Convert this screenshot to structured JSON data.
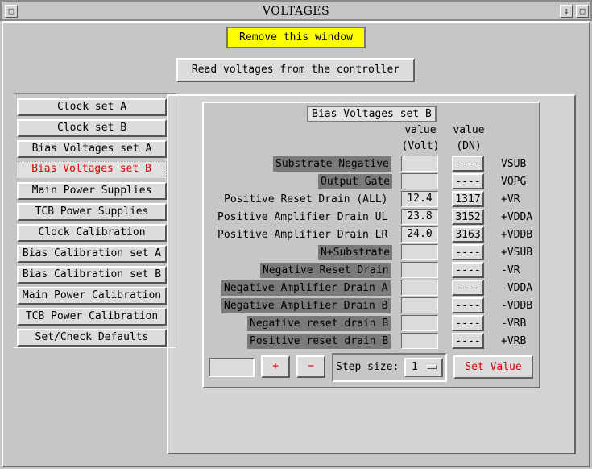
{
  "window": {
    "title": "VOLTAGES",
    "controls": [
      "□",
      "↕",
      "□"
    ]
  },
  "top": {
    "remove_label": "Remove this window",
    "read_label": "Read voltages from the controller"
  },
  "sidebar": {
    "items": [
      {
        "label": "Clock set A"
      },
      {
        "label": "Clock set B"
      },
      {
        "label": "Bias Voltages set A"
      },
      {
        "label": "Bias Voltages set B"
      },
      {
        "label": "Main Power Supplies"
      },
      {
        "label": "TCB Power Supplies"
      },
      {
        "label": "Clock Calibration"
      },
      {
        "label": "Bias Calibration set A"
      },
      {
        "label": "Bias Calibration set B"
      },
      {
        "label": "Main Power Calibration"
      },
      {
        "label": "TCB Power Calibration"
      },
      {
        "label": "Set/Check Defaults"
      }
    ],
    "active_index": 3
  },
  "panel": {
    "title": "Bias Voltages set B",
    "col_value": "value",
    "col_volt": "(Volt)",
    "col_dn": "(DN)",
    "rows": [
      {
        "label": "Substrate Negative",
        "volt": "",
        "dn": "----",
        "abbr": "VSUB",
        "dark": true
      },
      {
        "label": "Output Gate",
        "volt": "",
        "dn": "----",
        "abbr": "VOPG",
        "dark": true
      },
      {
        "label": "Positive Reset Drain (ALL)",
        "volt": "12.4",
        "dn": "1317",
        "abbr": "+VR",
        "dark": false
      },
      {
        "label": "Positive Amplifier Drain UL",
        "volt": "23.8",
        "dn": "3152",
        "abbr": "+VDDA",
        "dark": false
      },
      {
        "label": "Positive Amplifier Drain LR",
        "volt": "24.0",
        "dn": "3163",
        "abbr": "+VDDB",
        "dark": false
      },
      {
        "label": "N+Substrate",
        "volt": "",
        "dn": "----",
        "abbr": "+VSUB",
        "dark": true
      },
      {
        "label": "Negative Reset Drain",
        "volt": "",
        "dn": "----",
        "abbr": "-VR",
        "dark": true
      },
      {
        "label": "Negative Amplifier Drain A",
        "volt": "",
        "dn": "----",
        "abbr": "-VDDA",
        "dark": true
      },
      {
        "label": "Negative Amplifier Drain B",
        "volt": "",
        "dn": "----",
        "abbr": "-VDDB",
        "dark": true
      },
      {
        "label": "Negative reset drain B",
        "volt": "",
        "dn": "----",
        "abbr": "-VRB",
        "dark": true
      },
      {
        "label": "Positive reset drain B",
        "volt": "",
        "dn": "----",
        "abbr": "+VRB",
        "dark": true
      }
    ],
    "controls": {
      "value_field": "",
      "plus_label": "+",
      "minus_label": "−",
      "step_label": "Step size:",
      "step_value": "1",
      "set_label": "Set Value"
    }
  }
}
